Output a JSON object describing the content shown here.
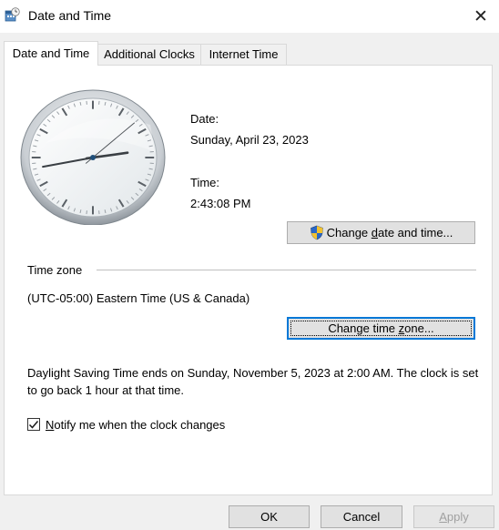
{
  "window": {
    "title": "Date and Time",
    "icon": "date-time-app-icon",
    "close_glyph": "✕"
  },
  "tabs": [
    {
      "label": "Date and Time",
      "active": true
    },
    {
      "label": "Additional Clocks",
      "active": false
    },
    {
      "label": "Internet Time",
      "active": false
    }
  ],
  "date": {
    "label": "Date:",
    "value": "Sunday, April 23, 2023"
  },
  "time": {
    "label": "Time:",
    "value": "2:43:08 PM"
  },
  "clock": {
    "hour": 2,
    "minute": 43,
    "second": 8
  },
  "change_datetime_button": {
    "pre": "Change ",
    "accel": "d",
    "post": "ate and time...",
    "icon": "uac-shield-icon"
  },
  "timezone": {
    "header": "Time zone",
    "value": "(UTC-05:00) Eastern Time (US & Canada)",
    "button_pre": "Change time ",
    "button_accel": "z",
    "button_post": "one..."
  },
  "dst_text": "Daylight Saving Time ends on Sunday, November 5, 2023 at 2:00 AM. The clock is set to go back 1 hour at that time.",
  "notify": {
    "checked": true,
    "accel": "N",
    "label_rest": "otify me when the clock changes"
  },
  "footer": {
    "ok": "OK",
    "cancel": "Cancel",
    "apply_accel": "A",
    "apply_rest": "pply"
  }
}
